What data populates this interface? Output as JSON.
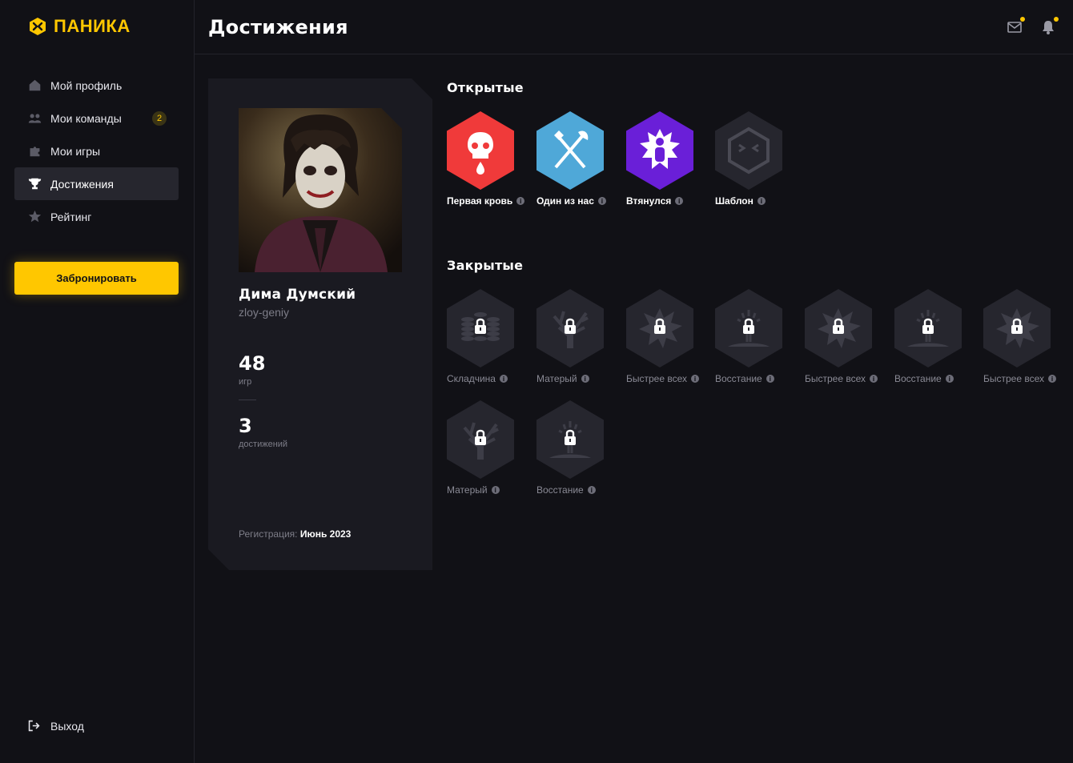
{
  "brand": {
    "name": "ПАНИКА",
    "accent": "#ffc700"
  },
  "sidebar": {
    "items": [
      {
        "label": "Мой профиль",
        "icon": "home-icon",
        "active": false
      },
      {
        "label": "Мои команды",
        "icon": "team-icon",
        "active": false,
        "badge": "2"
      },
      {
        "label": "Мои игры",
        "icon": "puzzle-icon",
        "active": false
      },
      {
        "label": "Достижения",
        "icon": "trophy-icon",
        "active": true
      },
      {
        "label": "Рейтинг",
        "icon": "star-icon",
        "active": false
      }
    ],
    "book_button": "Забронировать",
    "logout": "Выход"
  },
  "header": {
    "title": "Достижения",
    "icons": [
      "mail-icon",
      "bell-icon"
    ]
  },
  "profile": {
    "name": "Дима Думский",
    "login": "zloy-geniy",
    "games_count": "48",
    "games_label": "игр",
    "achievements_count": "3",
    "achievements_label": "достижений",
    "registration_label": "Регистрация:",
    "registration_date": "Июнь 2023"
  },
  "open_section": {
    "title": "Открытые",
    "items": [
      {
        "label": "Первая кровь",
        "icon": "skull-icon",
        "color": "#f03a3a"
      },
      {
        "label": "Один из нас",
        "icon": "crossed-weapons-icon",
        "color": "#4fa8d8"
      },
      {
        "label": "Втянулся",
        "icon": "person-burst-icon",
        "color": "#6a1fd8"
      },
      {
        "label": "Шаблон",
        "icon": "template-face-icon",
        "color": "#2a2a32"
      }
    ]
  },
  "closed_section": {
    "title": "Закрытые",
    "items": [
      {
        "label": "Складчина",
        "icon": "coins-lock-icon"
      },
      {
        "label": "Матерый",
        "icon": "tree-lock-icon"
      },
      {
        "label": "Быстрее всех",
        "icon": "burst-lock-icon"
      },
      {
        "label": "Восстание",
        "icon": "rise-lock-icon"
      },
      {
        "label": "Быстрее всех",
        "icon": "burst-lock-icon"
      },
      {
        "label": "Восстание",
        "icon": "rise-lock-icon"
      },
      {
        "label": "Быстрее всех",
        "icon": "burst-lock-icon"
      },
      {
        "label": "Матерый",
        "icon": "tree-lock-icon"
      },
      {
        "label": "Восстание",
        "icon": "rise-lock-icon"
      }
    ]
  }
}
